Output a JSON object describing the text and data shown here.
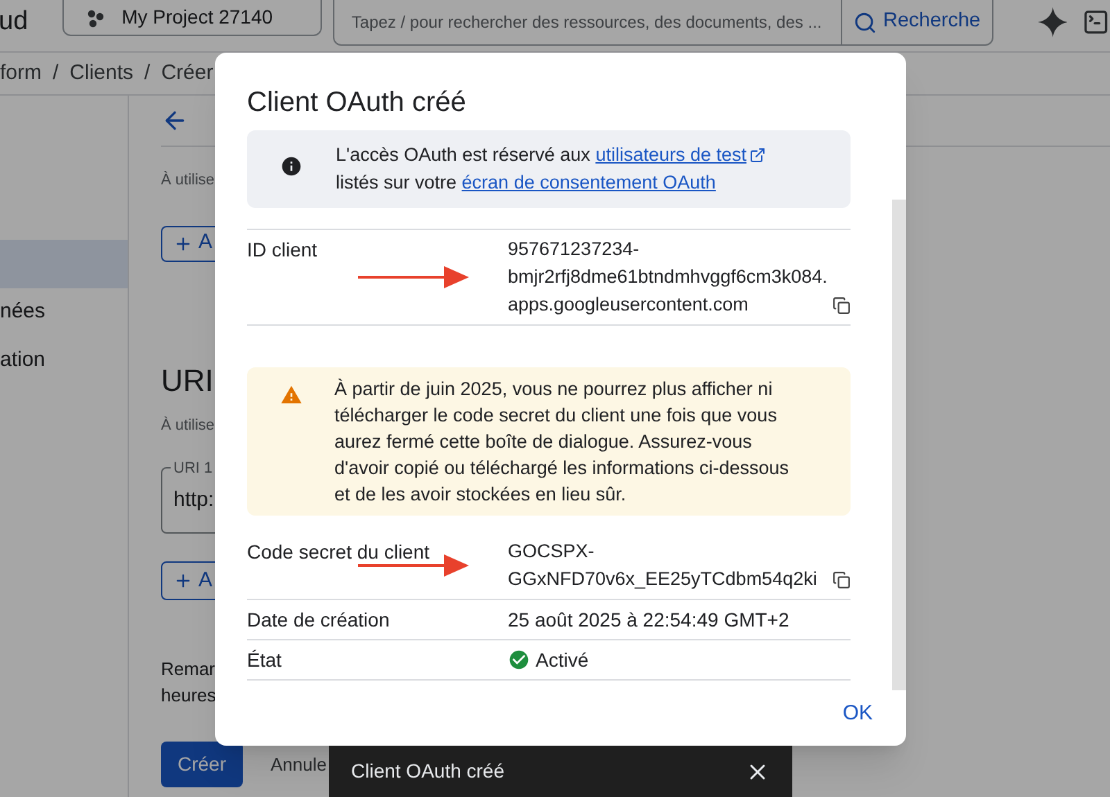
{
  "topbar": {
    "brand": "ud",
    "project": "My Project 27140",
    "search": {
      "placeholder": "Tapez / pour rechercher des ressources, des documents, des ..."
    },
    "search_button": "Recherche"
  },
  "breadcrumb": [
    "form",
    "/",
    "Clients",
    "/",
    "Créer"
  ],
  "sidebar": {
    "items": [
      {
        "selected": true
      },
      {
        "label": "nées",
        "selected": false
      },
      {
        "label": "ation",
        "selected": false
      }
    ]
  },
  "main": {
    "hint_1": "À utilise",
    "add_button_1": "A",
    "heading": "URI",
    "hint_2": "À utilise",
    "uri_field": {
      "label": "URI 1",
      "value": "http:"
    },
    "add_button_2": "A",
    "note_lines": [
      "Remar",
      "heures"
    ],
    "create_button": "Créer",
    "cancel_button": "Annule"
  },
  "dialog": {
    "title": "Client OAuth créé",
    "info": {
      "before": "L'accès OAuth est réservé aux",
      "link_1": "utilisateurs de test",
      "middle": "listés sur votre",
      "link_2": "écran de consentement OAuth"
    },
    "rows": [
      {
        "kind": "secret",
        "label": "ID client",
        "value_lines": [
          "957671237234-",
          "bmjr2rfj8dme61btndmhvggf6cm3k084.",
          "apps.googleusercontent.com"
        ]
      },
      {
        "kind": "warning",
        "text": "À partir de juin 2025, vous ne pourrez plus afficher ni télécharger le code secret du client une fois que vous aurez fermé cette boîte de dialogue. Assurez-vous d'avoir copié ou téléchargé les informations ci-dessous et de les avoir stockées en lieu sûr."
      },
      {
        "kind": "secret",
        "label": "Code secret du client",
        "value_lines": [
          "GOCSPX-",
          "GGxNFD70v6x_EE25yTCdbm54q2ki"
        ]
      },
      {
        "kind": "plain",
        "label": "Date de création",
        "value": "25 août 2025 à 22:54:49 GMT+2"
      },
      {
        "kind": "status",
        "label": "État",
        "value": "Activé",
        "enabled": true
      }
    ],
    "ok_button": "OK"
  },
  "snackbar": {
    "message": "Client OAuth créé"
  }
}
